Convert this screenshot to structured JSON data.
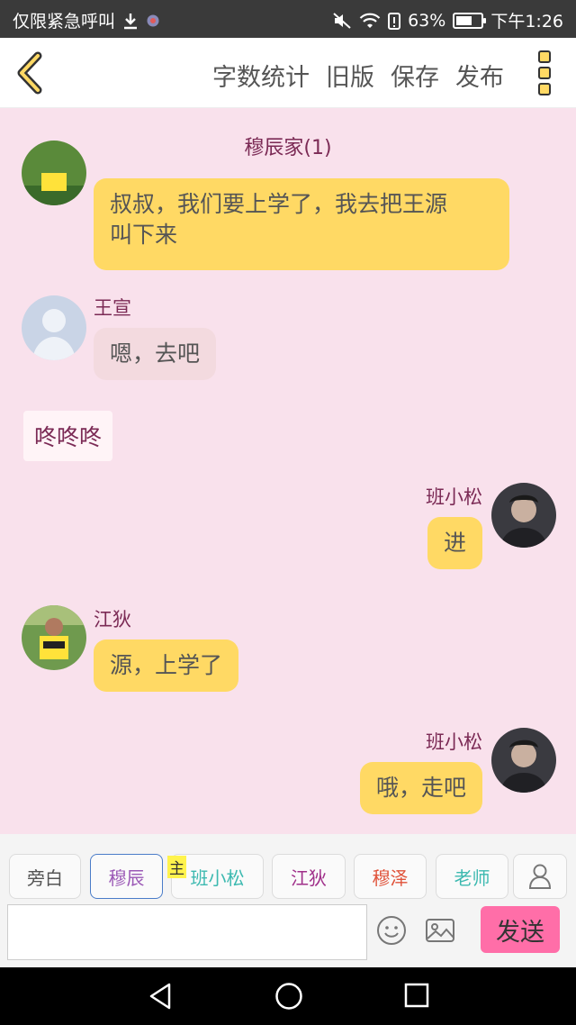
{
  "status_bar": {
    "left_text": "仅限紧急呼叫",
    "battery": "63%",
    "battery_level": 0.63,
    "time": "下午1:26"
  },
  "navbar": {
    "back_icon": "chevron-left-icon",
    "actions": [
      "字数统计",
      "旧版",
      "保存",
      "发布"
    ],
    "more_icon": "more-vertical-icon"
  },
  "chat": {
    "title": "穆辰家(1)",
    "messages": [
      {
        "text_line1": "叔叔，我们要上学了，我去把王源",
        "text_line2": "叫下来"
      },
      {
        "sender": "王宣",
        "text": "嗯，去吧"
      },
      {
        "narration": "咚咚咚"
      },
      {
        "sender": "班小松",
        "text": "进"
      },
      {
        "sender": "江狄",
        "text": "源，上学了"
      },
      {
        "sender": "班小松",
        "text": "哦，走吧"
      }
    ]
  },
  "roles": {
    "items": [
      {
        "label": "旁白",
        "color": "#555555"
      },
      {
        "label": "穆辰",
        "color": "#9b59b6"
      },
      {
        "label": "班小松",
        "color": "#3cb9b0"
      },
      {
        "label": "江狄",
        "color": "#a0308a"
      },
      {
        "label": "穆泽",
        "color": "#e0533a"
      },
      {
        "label": "老师",
        "color": "#3cb9b0"
      }
    ],
    "main_tag": "主",
    "user_icon": "user-icon"
  },
  "input": {
    "value": "",
    "placeholder": "",
    "send_label": "发送"
  }
}
